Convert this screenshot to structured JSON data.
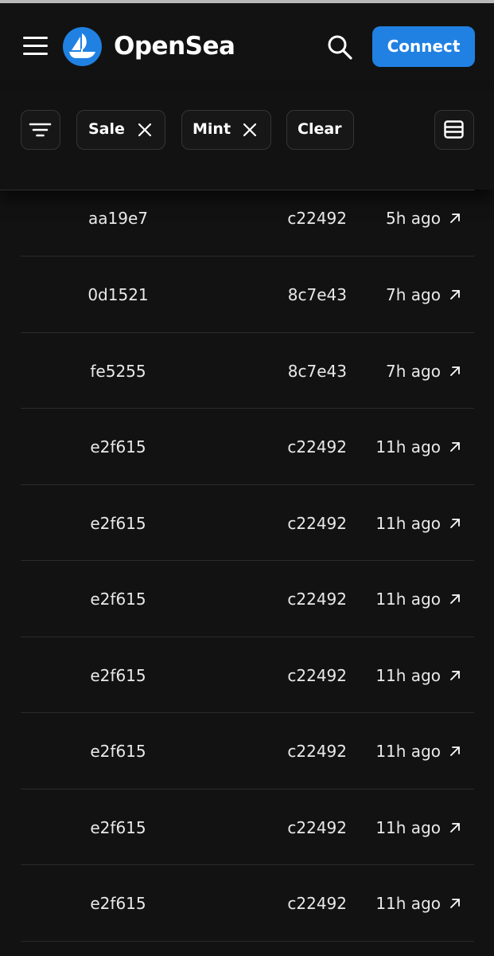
{
  "header": {
    "brand": "OpenSea",
    "connect_label": "Connect",
    "accent_color": "#2081e2"
  },
  "icons": {
    "menu": "hamburger-menu-icon",
    "logo": "opensea-boat-logo-icon",
    "search": "magnifying-glass-search-icon",
    "filter": "filter-lines-icon",
    "remove": "close-x-icon",
    "view": "list-view-icon",
    "external": "arrow-up-right-icon"
  },
  "filters": {
    "chips": [
      {
        "label": "Sale"
      },
      {
        "label": "Mint"
      }
    ],
    "clear_label": "Clear"
  },
  "activity": {
    "rows": [
      {
        "from": "aa19e7",
        "to": "c22492",
        "time": "5h ago"
      },
      {
        "from": "0d1521",
        "to": "8c7e43",
        "time": "7h ago"
      },
      {
        "from": "fe5255",
        "to": "8c7e43",
        "time": "7h ago"
      },
      {
        "from": "e2f615",
        "to": "c22492",
        "time": "11h ago"
      },
      {
        "from": "e2f615",
        "to": "c22492",
        "time": "11h ago"
      },
      {
        "from": "e2f615",
        "to": "c22492",
        "time": "11h ago"
      },
      {
        "from": "e2f615",
        "to": "c22492",
        "time": "11h ago"
      },
      {
        "from": "e2f615",
        "to": "c22492",
        "time": "11h ago"
      },
      {
        "from": "e2f615",
        "to": "c22492",
        "time": "11h ago"
      },
      {
        "from": "e2f615",
        "to": "c22492",
        "time": "11h ago"
      }
    ]
  }
}
